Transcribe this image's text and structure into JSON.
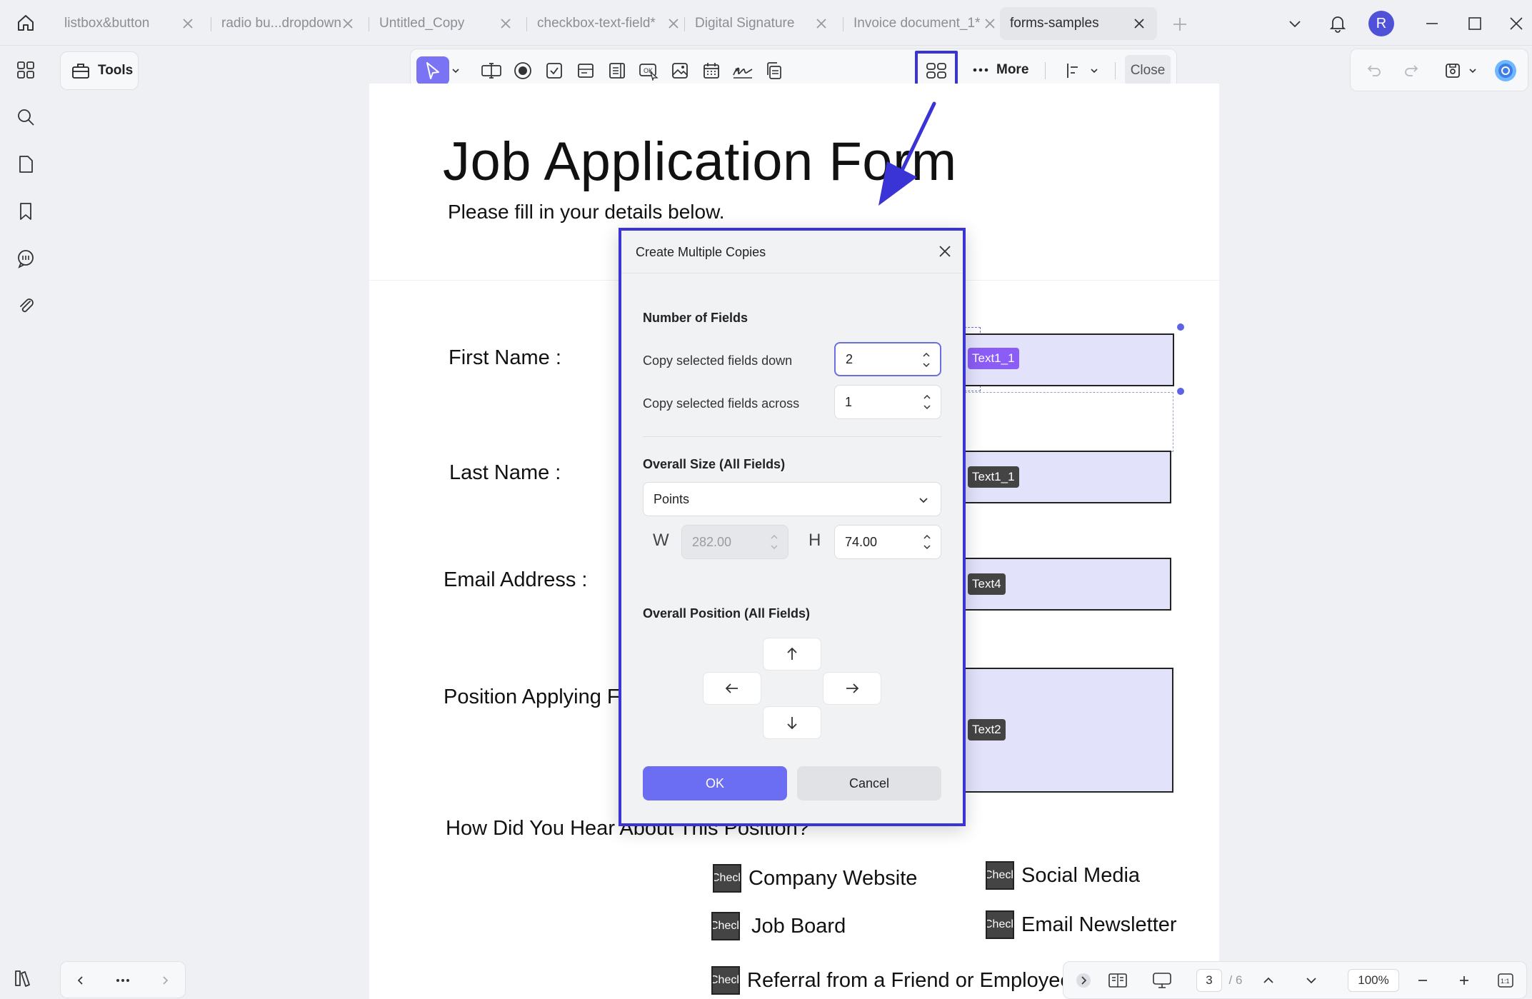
{
  "tabs": [
    {
      "label": "listbox&button",
      "active": false
    },
    {
      "label": "radio bu...dropdown",
      "active": false
    },
    {
      "label": "Untitled_Copy",
      "active": false
    },
    {
      "label": "checkbox-text-field*",
      "active": false
    },
    {
      "label": "Digital Signature",
      "active": false
    },
    {
      "label": "Invoice document_1*",
      "active": false
    },
    {
      "label": "forms-samples",
      "active": true
    }
  ],
  "user": {
    "avatar_letter": "R"
  },
  "toolbar": {
    "tools_label": "Tools",
    "more_label": "More",
    "close_label": "Close"
  },
  "document": {
    "title": "Job Application Form",
    "subtitle": "Please fill in your details below.",
    "labels": {
      "first_name": "First Name :",
      "last_name": "Last Name :",
      "email": "Email Address :",
      "position": "Position Applying For :",
      "hear_about": "How Did You Hear About This Position?"
    },
    "field_tags": {
      "first_name": "Text1_1",
      "last_name": "Text1_1",
      "email": "Text4",
      "position": "Text2"
    },
    "checkbox_tag": "Check Box",
    "checkbox_options": [
      "Company Website",
      "Social Media",
      "Job Board",
      "Email Newsletter",
      "Referral from a Friend or Employee"
    ]
  },
  "dialog": {
    "title": "Create Multiple Copies",
    "number_of_fields_heading": "Number of Fields",
    "copy_down_label": "Copy selected fields down",
    "copy_down_value": "2",
    "copy_across_label": "Copy selected fields across",
    "copy_across_value": "1",
    "overall_size_heading": "Overall Size (All Fields)",
    "units_selected": "Points",
    "width_label": "W",
    "width_value": "282.00",
    "height_label": "H",
    "height_value": "74.00",
    "overall_position_heading": "Overall Position (All Fields)",
    "ok_label": "OK",
    "cancel_label": "Cancel"
  },
  "status_bar": {
    "current_page": "3",
    "total_pages": "/ 6",
    "zoom": "100%"
  },
  "colors": {
    "accent": "#6b6ef2",
    "highlight_border": "#3a34d6",
    "field_fill": "#e2e2fb",
    "selected_tag": "#8b5cf6"
  }
}
